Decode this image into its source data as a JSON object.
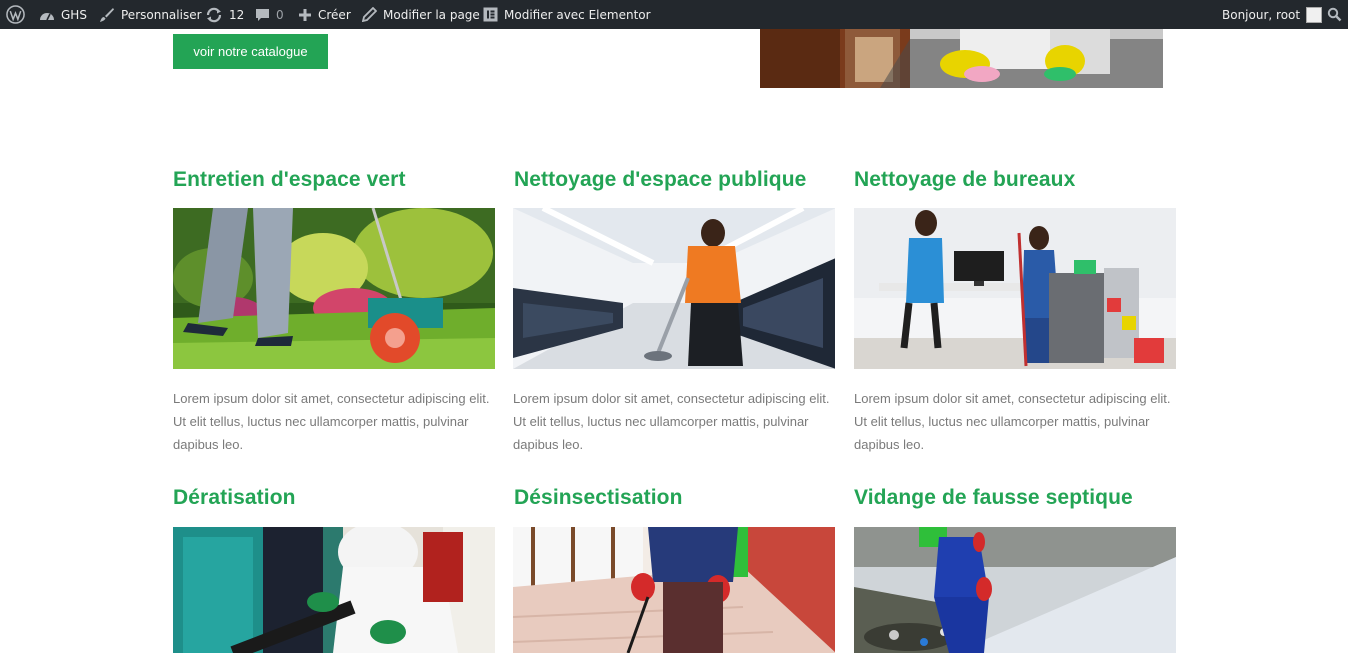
{
  "adminbar": {
    "site_name": "GHS",
    "customize": "Personnaliser",
    "updates_count": "12",
    "comments_count": "0",
    "new_label": "Créer",
    "edit_page": "Modifier la page",
    "edit_elementor": "Modifier avec Elementor",
    "greeting": "Bonjour, root"
  },
  "hero": {
    "cta_label": "voir notre catalogue"
  },
  "services": [
    {
      "title": "Entretien d'espace vert",
      "desc": "Lorem ipsum dolor sit amet, consectetur adipiscing elit. Ut elit tellus, luctus nec ullamcorper mattis, pulvinar dapibus leo."
    },
    {
      "title": "Nettoyage d'espace publique",
      "desc": "Lorem ipsum dolor sit amet, consectetur adipiscing elit. Ut elit tellus, luctus nec ullamcorper mattis, pulvinar dapibus leo."
    },
    {
      "title": "Nettoyage de bureaux",
      "desc": "Lorem ipsum dolor sit amet, consectetur adipiscing elit. Ut elit tellus, luctus nec ullamcorper mattis, pulvinar dapibus leo."
    },
    {
      "title": "Dératisation"
    },
    {
      "title": "Désinsectisation"
    },
    {
      "title": "Vidange de fausse septique"
    }
  ],
  "colors": {
    "accent": "#23a455",
    "adminbar_bg": "#23282d",
    "body_text": "#7a7a7a"
  }
}
